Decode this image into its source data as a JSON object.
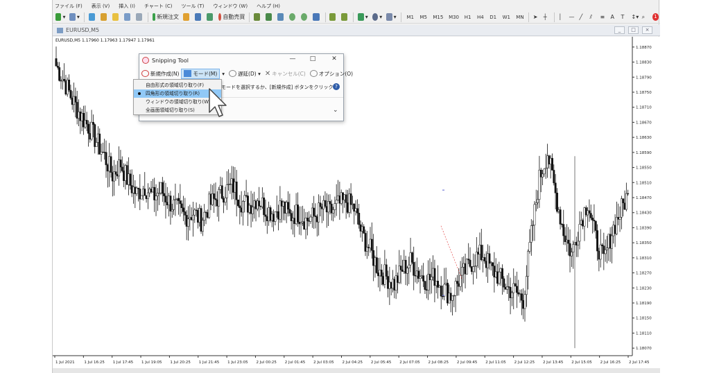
{
  "menu": [
    "ファイル (F)",
    "表示 (V)",
    "挿入 (I)",
    "チャート (C)",
    "ツール (T)",
    "ウィンドウ (W)",
    "ヘルプ (H)"
  ],
  "toolbar": {
    "new_order": "新規注文",
    "autotrade": "自動売買",
    "timeframes": [
      "M1",
      "M5",
      "M15",
      "M30",
      "H1",
      "H4",
      "D1",
      "W1",
      "MN"
    ],
    "alert_count": "1"
  },
  "window": {
    "title": "EURUSD,M5",
    "controls": [
      "_",
      "□",
      "×"
    ]
  },
  "chart_symbol": "EURUSD,M5 1.17960 1.17963 1.17947 1.17961",
  "chart_data": {
    "type": "candlestick",
    "y_ticks": [
      "1.18870",
      "1.18830",
      "1.18790",
      "1.18750",
      "1.18710",
      "1.18670",
      "1.18630",
      "1.18590",
      "1.18550",
      "1.18510",
      "1.18470",
      "1.18430",
      "1.18390",
      "1.18350",
      "1.18310",
      "1.18270",
      "1.18230",
      "1.18190",
      "1.18150",
      "1.18110",
      "1.18070"
    ],
    "x_ticks": [
      "1 Jul 2021",
      "1 Jul 16:25",
      "1 Jul 17:45",
      "1 Jul 19:05",
      "1 Jul 20:25",
      "1 Jul 21:45",
      "1 Jul 23:05",
      "2 Jul 00:25",
      "2 Jul 01:45",
      "2 Jul 03:05",
      "2 Jul 04:25",
      "2 Jul 05:45",
      "2 Jul 07:05",
      "2 Jul 08:25",
      "2 Jul 09:45",
      "2 Jul 11:05",
      "2 Jul 12:25",
      "2 Jul 13:45",
      "2 Jul 15:05",
      "2 Jul 16:25",
      "2 Jul 17:45"
    ],
    "ylim": [
      1.1805,
      1.1889
    ],
    "close": [
      1.1882,
      1.1878,
      1.1873,
      1.1869,
      1.1866,
      1.1862,
      1.1858,
      1.1853,
      1.1856,
      1.1851,
      1.1848,
      1.185,
      1.1847,
      1.1849,
      1.1846,
      1.1844,
      1.1842,
      1.1843,
      1.1841,
      1.1845,
      1.1847,
      1.1849,
      1.185,
      1.1846,
      1.1845,
      1.1847,
      1.1844,
      1.1843,
      1.1845,
      1.1842,
      1.1843,
      1.1841,
      1.1842,
      1.1844,
      1.1843,
      1.1845,
      1.1846,
      1.1844,
      1.1837,
      1.1833,
      1.1828,
      1.1826,
      1.1824,
      1.1828,
      1.183,
      1.1827,
      1.1825,
      1.1826,
      1.1823,
      1.1821,
      1.1825,
      1.1828,
      1.1831,
      1.1832,
      1.1828,
      1.1826,
      1.1823,
      1.1822,
      1.182,
      1.1837,
      1.1852,
      1.1859,
      1.1848,
      1.1838,
      1.1832,
      1.184,
      1.1846,
      1.1836,
      1.183,
      1.1838,
      1.1843,
      1.1848
    ],
    "annotations": [
      "1.18490",
      "1.18210"
    ]
  },
  "snipping": {
    "title": "Snipping Tool",
    "controls": [
      "—",
      "□",
      "✕"
    ],
    "new_label": "新規作成(N)",
    "mode_label": "モード(M)",
    "delay_label": "遅延(D)",
    "cancel_label": "キャンセル(C)",
    "options_label": "オプション(O)",
    "message": "モードを選択するか、[新規作成] ボタンをクリック",
    "help": "?",
    "expand": "⌄"
  },
  "dropdown": {
    "items": [
      "自由形式の領域切り取り(F)",
      "四角形の領域切り取り(R)",
      "ウィンドウの領域切り取り(W)",
      "全画面領域切り取り(S)"
    ]
  },
  "colors": {
    "candle": "#111111",
    "highlight": "#91c9f7",
    "accent_red": "#e03030"
  }
}
